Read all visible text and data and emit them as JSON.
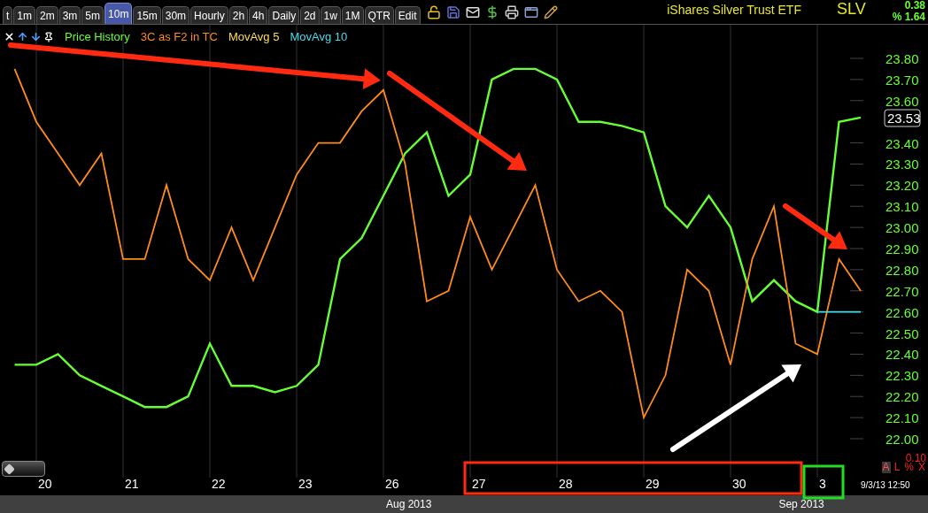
{
  "toolbar": {
    "tabs": [
      {
        "label": "t",
        "selected": false
      },
      {
        "label": "1m",
        "selected": false
      },
      {
        "label": "2m",
        "selected": false
      },
      {
        "label": "3m",
        "selected": false
      },
      {
        "label": "5m",
        "selected": false
      },
      {
        "label": "10m",
        "selected": true
      },
      {
        "label": "15m",
        "selected": false
      },
      {
        "label": "30m",
        "selected": false
      },
      {
        "label": "Hourly",
        "selected": false
      },
      {
        "label": "2h",
        "selected": false
      },
      {
        "label": "4h",
        "selected": false
      },
      {
        "label": "Daily",
        "selected": false
      },
      {
        "label": "2d",
        "selected": false
      },
      {
        "label": "1w",
        "selected": false
      },
      {
        "label": "1M",
        "selected": false
      },
      {
        "label": "QTR",
        "selected": false
      },
      {
        "label": "Edit",
        "selected": false
      }
    ],
    "security_name": "iShares Silver Trust ETF",
    "symbol": "SLV",
    "change": "0.38",
    "change_percent": "% 1.64"
  },
  "chart": {
    "last_price": "23.53",
    "scale_reading": "0.10",
    "scale_buttons": [
      {
        "label": "A",
        "selected": true
      },
      {
        "label": "L",
        "selected": false
      },
      {
        "label": "%",
        "selected": false
      },
      {
        "label": "X",
        "selected": false
      }
    ],
    "timestamp": "9/3/13 12:50",
    "months": [
      "Aug 2013",
      "Sep 2013"
    ],
    "chart_data": {
      "type": "line",
      "categories": [
        null,
        "20",
        null,
        null,
        null,
        "21",
        null,
        null,
        null,
        "22",
        null,
        null,
        null,
        "23",
        null,
        null,
        null,
        "26",
        null,
        null,
        null,
        "27",
        null,
        null,
        null,
        "28",
        null,
        null,
        null,
        "29",
        null,
        null,
        null,
        "30",
        null,
        null,
        null,
        "3",
        null,
        null
      ],
      "series": [
        {
          "name": "Price History",
          "color": "#66ff33",
          "values": [
            22.35,
            22.35,
            22.4,
            22.3,
            22.25,
            22.2,
            22.15,
            22.15,
            22.2,
            22.45,
            22.25,
            22.25,
            22.22,
            22.25,
            22.35,
            22.85,
            22.95,
            23.15,
            23.35,
            23.45,
            23.15,
            23.25,
            23.7,
            23.75,
            23.75,
            23.7,
            23.5,
            23.5,
            23.48,
            23.45,
            23.1,
            23.0,
            23.15,
            23.0,
            22.65,
            22.75,
            22.65,
            22.6,
            23.5,
            23.52
          ]
        },
        {
          "name": "3C as F2 in TC",
          "color": "#ff8c1a",
          "values": [
            23.75,
            23.5,
            23.35,
            23.2,
            23.35,
            22.85,
            22.85,
            23.2,
            22.85,
            22.75,
            23.0,
            22.75,
            23.0,
            23.25,
            23.4,
            23.4,
            23.55,
            23.65,
            23.3,
            22.65,
            22.7,
            23.05,
            22.8,
            23.0,
            23.2,
            22.8,
            22.65,
            22.7,
            22.6,
            22.1,
            22.3,
            22.8,
            22.7,
            22.35,
            22.85,
            23.1,
            22.45,
            22.4,
            22.85,
            22.7
          ]
        },
        {
          "name": "MovAvg 5",
          "color": "#ffdd55",
          "values": [
            null,
            null,
            null,
            null,
            null,
            null,
            null,
            null,
            null,
            null,
            null,
            null,
            null,
            null,
            null,
            null,
            null,
            null,
            null,
            null,
            null,
            null,
            null,
            null,
            null,
            null,
            null,
            null,
            null,
            null,
            null,
            null,
            null,
            null,
            null,
            null,
            null,
            null,
            null,
            null
          ]
        },
        {
          "name": "MovAvg 10",
          "color": "#44ddee",
          "values": [
            null,
            null,
            null,
            null,
            null,
            null,
            null,
            null,
            null,
            null,
            null,
            null,
            null,
            null,
            null,
            null,
            null,
            null,
            null,
            null,
            null,
            null,
            null,
            null,
            null,
            null,
            null,
            null,
            null,
            null,
            null,
            null,
            null,
            null,
            null,
            null,
            null,
            22.6,
            22.6,
            22.6
          ]
        }
      ],
      "ylim": [
        22.0,
        23.8
      ],
      "yticks": [
        {
          "value": 22.0,
          "label": "22.00"
        },
        {
          "value": 22.1,
          "label": "22.10"
        },
        {
          "value": 22.2,
          "label": "22.20"
        },
        {
          "value": 22.3,
          "label": "22.30"
        },
        {
          "value": 22.4,
          "label": "22.40"
        },
        {
          "value": 22.5,
          "label": "22.50"
        },
        {
          "value": 22.6,
          "label": "22.60"
        },
        {
          "value": 22.7,
          "label": "22.70"
        },
        {
          "value": 22.8,
          "label": "22.80"
        },
        {
          "value": 22.9,
          "label": "22.90"
        },
        {
          "value": 23.0,
          "label": "23.00"
        },
        {
          "value": 23.1,
          "label": "23.10"
        },
        {
          "value": 23.2,
          "label": "23.20"
        },
        {
          "value": 23.3,
          "label": "23.30"
        },
        {
          "value": 23.4,
          "label": "23.40"
        },
        {
          "value": 23.6,
          "label": "23.60"
        },
        {
          "value": 23.7,
          "label": "23.70"
        },
        {
          "value": 23.8,
          "label": "23.80"
        }
      ]
    }
  }
}
